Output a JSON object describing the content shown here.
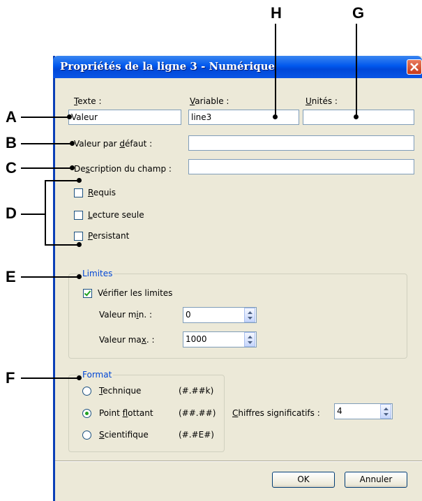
{
  "dialog": {
    "title": "Propriétés de la ligne 3 - Numérique",
    "texte_label": "Texte :",
    "texte_value": "Valeur",
    "variable_label": "Variable :",
    "variable_value": "line3",
    "unites_label": "Unités :",
    "unites_value": "",
    "default_label": "Valeur par défaut :",
    "default_value": "",
    "description_label": "Description du champ :",
    "description_value": "",
    "requis_label": "Requis",
    "requis_checked": false,
    "lecture_label": "Lecture seule",
    "lecture_checked": false,
    "persistant_label": "Persistant",
    "persistant_checked": false,
    "limites": {
      "legend": "Limites",
      "verify_label": "Vérifier les limites",
      "verify_checked": true,
      "min_label": "Valeur min. :",
      "min_value": "0",
      "max_label": "Valeur max. :",
      "max_value": "1000"
    },
    "format": {
      "legend": "Format",
      "options": [
        {
          "label": "Technique",
          "pattern": "(#.##k)",
          "selected": false
        },
        {
          "label": "Point flottant",
          "pattern": "(##.##)",
          "selected": true
        },
        {
          "label": "Scientifique",
          "pattern": "(#.#E#)",
          "selected": false
        }
      ],
      "digits_label": "Chiffres significatifs :",
      "digits_value": "4"
    },
    "ok_label": "OK",
    "cancel_label": "Annuler"
  },
  "callouts": {
    "a": "A",
    "b": "B",
    "c": "C",
    "d": "D",
    "e": "E",
    "f": "F",
    "g": "G",
    "h": "H"
  },
  "colors": {
    "titlebar": "#0058ee",
    "legend": "#0046d5",
    "check": "#21a121",
    "close": "#c83a1a"
  }
}
